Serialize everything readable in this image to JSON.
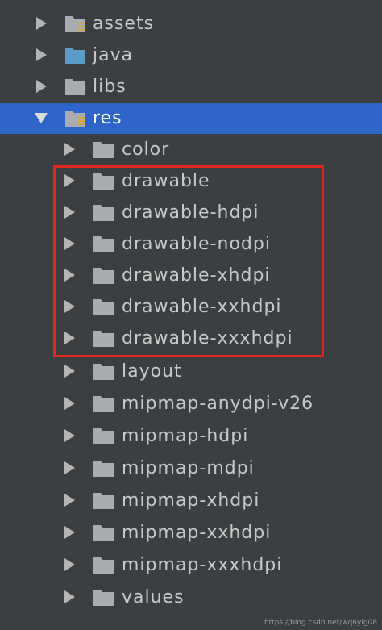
{
  "tree": {
    "items": [
      {
        "label": "assets",
        "icon": "resource-folder-icon",
        "expanded": false,
        "selected": false,
        "level": 0
      },
      {
        "label": "java",
        "icon": "source-folder-icon",
        "expanded": false,
        "selected": false,
        "level": 0
      },
      {
        "label": "libs",
        "icon": "folder-icon",
        "expanded": false,
        "selected": false,
        "level": 0
      },
      {
        "label": "res",
        "icon": "resource-folder-icon",
        "expanded": true,
        "selected": true,
        "level": 0
      },
      {
        "label": "color",
        "icon": "folder-icon",
        "expanded": false,
        "selected": false,
        "level": 1
      },
      {
        "label": "drawable",
        "icon": "folder-icon",
        "expanded": false,
        "selected": false,
        "level": 1
      },
      {
        "label": "drawable-hdpi",
        "icon": "folder-icon",
        "expanded": false,
        "selected": false,
        "level": 1
      },
      {
        "label": "drawable-nodpi",
        "icon": "folder-icon",
        "expanded": false,
        "selected": false,
        "level": 1
      },
      {
        "label": "drawable-xhdpi",
        "icon": "folder-icon",
        "expanded": false,
        "selected": false,
        "level": 1
      },
      {
        "label": "drawable-xxhdpi",
        "icon": "folder-icon",
        "expanded": false,
        "selected": false,
        "level": 1
      },
      {
        "label": "drawable-xxxhdpi",
        "icon": "folder-icon",
        "expanded": false,
        "selected": false,
        "level": 1
      },
      {
        "label": "layout",
        "icon": "folder-icon",
        "expanded": false,
        "selected": false,
        "level": 1
      },
      {
        "label": "mipmap-anydpi-v26",
        "icon": "folder-icon",
        "expanded": false,
        "selected": false,
        "level": 1
      },
      {
        "label": "mipmap-hdpi",
        "icon": "folder-icon",
        "expanded": false,
        "selected": false,
        "level": 1
      },
      {
        "label": "mipmap-mdpi",
        "icon": "folder-icon",
        "expanded": false,
        "selected": false,
        "level": 1
      },
      {
        "label": "mipmap-xhdpi",
        "icon": "folder-icon",
        "expanded": false,
        "selected": false,
        "level": 1
      },
      {
        "label": "mipmap-xxhdpi",
        "icon": "folder-icon",
        "expanded": false,
        "selected": false,
        "level": 1
      },
      {
        "label": "mipmap-xxxhdpi",
        "icon": "folder-icon",
        "expanded": false,
        "selected": false,
        "level": 1
      },
      {
        "label": "values",
        "icon": "folder-icon",
        "expanded": false,
        "selected": false,
        "level": 1
      }
    ]
  },
  "annotation": {
    "color": "#e0281e"
  },
  "watermark": "https://blog.csdn.net/wq6ylg08",
  "colors": {
    "background": "#3c3f41",
    "selection": "#2f65ca",
    "folder": "#a9adb2",
    "source_folder": "#5b9bc7",
    "resource_stripes": "#d8a642"
  }
}
